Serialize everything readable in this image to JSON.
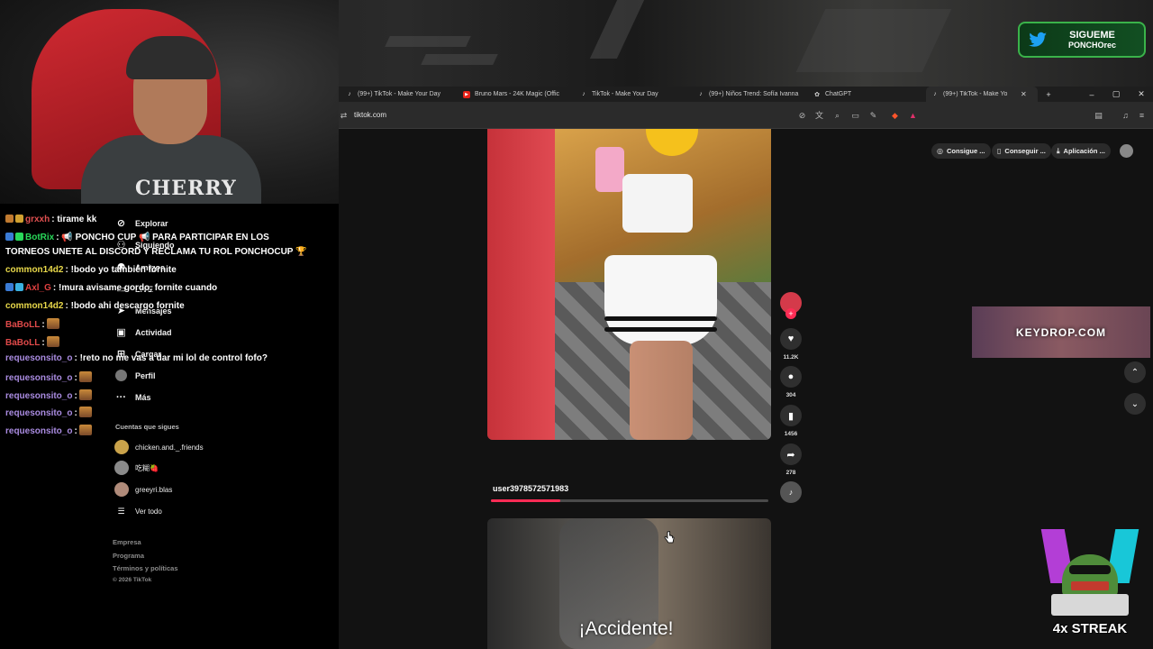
{
  "overlay": {
    "twitter_line1": "SIGUEME",
    "twitter_line2": "PONCHOrec",
    "keydrop": "KEYDROP.COM",
    "streak": "4x STREAK",
    "webcam_shirt_text": "CHERRY"
  },
  "browser": {
    "tabs": [
      {
        "label": "(99+) TikTok - Make Your Day",
        "icon": "tiktok-icon"
      },
      {
        "label": "Bruno Mars - 24K Magic (Offic",
        "icon": "youtube-icon"
      },
      {
        "label": "TikTok - Make Your Day",
        "icon": "tiktok-icon"
      },
      {
        "label": "(99+) Niños Trend: Sofía Ivanna",
        "icon": "tiktok-icon"
      },
      {
        "label": "ChatGPT",
        "icon": "chatgpt-icon"
      },
      {
        "label": "(99+) TikTok - Make Yo",
        "icon": "tiktok-icon"
      }
    ],
    "url": "tiktok.com"
  },
  "sidebar": {
    "items": [
      {
        "label": "Explorar",
        "icon": "compass-icon"
      },
      {
        "label": "Siguiendo",
        "icon": "following-icon"
      },
      {
        "label": "Amigos",
        "icon": "friends-icon"
      },
      {
        "label": "LIVE",
        "icon": "live-icon"
      },
      {
        "label": "Mensajes",
        "icon": "messages-icon"
      },
      {
        "label": "Actividad",
        "icon": "activity-icon"
      },
      {
        "label": "Cargar",
        "icon": "upload-icon"
      },
      {
        "label": "Perfil",
        "icon": "profile-icon"
      },
      {
        "label": "Más",
        "icon": "more-icon"
      }
    ],
    "following_title": "Cuentas que sigues",
    "following": [
      {
        "name": "chicken.and._.friends",
        "color": "#c9a24a"
      },
      {
        "name": "吃糊🍓",
        "color": "#8a8a8a"
      },
      {
        "name": "greeyri.blas",
        "color": "#b08b7a"
      }
    ],
    "see_all": "Ver todo",
    "footer": [
      "Empresa",
      "Programa",
      "Términos y políticas",
      "© 2026 TikTok"
    ]
  },
  "video": {
    "author": "user3978572571983",
    "progress": 0.25,
    "likes": "11.2K",
    "comments": "304",
    "saves": "1456",
    "shares": "278",
    "next_caption": "¡Accidente!"
  },
  "header_pills": [
    {
      "label": "Consigue ...",
      "icon": "coin-icon"
    },
    {
      "label": "Conseguir ...",
      "icon": "phone-icon"
    },
    {
      "label": "Aplicación ...",
      "icon": "download-icon"
    }
  ],
  "chat": [
    {
      "name": "grxxh",
      "name_color": "#e05050",
      "message": ": tirame kk",
      "badges": [
        "#c07a30",
        "#d0a030"
      ]
    },
    {
      "name": "BotRix",
      "name_color": "#29d95a",
      "message": ": 📢 PONCHO CUP 📢 PARA PARTICIPAR EN LOS",
      "badges": [
        "#3a7bd5",
        "#29d95a"
      ]
    },
    {
      "name": "",
      "name_color": "#ffffff",
      "message": "TORNEOS UNETE AL DISCORD Y RECLAMA TU ROL PONCHOCUP 🏆",
      "badges": []
    },
    {
      "name": "common14d2",
      "name_color": "#e8d84a",
      "message": ": !bodo yo también fornite",
      "badges": []
    },
    {
      "name": "Axl_G",
      "name_color": "#e04040",
      "message": ": !mura avisame gordo, fornite cuando",
      "badges": [
        "#3a7bd5",
        "#3ab0e0"
      ]
    },
    {
      "name": "common14d2",
      "name_color": "#e8d84a",
      "message": ": !bodo ahi descargo fornite",
      "badges": []
    },
    {
      "name": "BaBoLL",
      "name_color": "#e04a4a",
      "message": ":",
      "badges": [],
      "emote": true
    },
    {
      "name": "BaBoLL",
      "name_color": "#e04a4a",
      "message": ":",
      "badges": [],
      "emote": true
    },
    {
      "name": "requesonsito_o",
      "name_color": "#a98be0",
      "message": ": !reto no me vas a dar mi lol de control fofo?",
      "badges": []
    },
    {
      "name": "requesonsito_o",
      "name_color": "#a98be0",
      "message": ":",
      "badges": [],
      "emote": true
    },
    {
      "name": "requesonsito_o",
      "name_color": "#a98be0",
      "message": ":",
      "badges": [],
      "emote": true
    },
    {
      "name": "requesonsito_o",
      "name_color": "#a98be0",
      "message": ":",
      "badges": [],
      "emote": true
    },
    {
      "name": "requesonsito_o",
      "name_color": "#a98be0",
      "message": ":",
      "badges": [],
      "emote": true
    }
  ]
}
